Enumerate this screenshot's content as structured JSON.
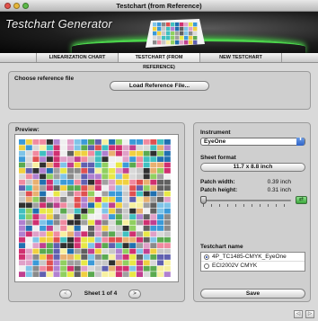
{
  "window": {
    "title": "Testchart (from Reference)"
  },
  "banner": {
    "title": "Testchart Generator"
  },
  "tabs": [
    {
      "label": "LINEARIZATION CHART",
      "active": false
    },
    {
      "label": "TESTCHART (FROM REFERENCE)",
      "active": true
    },
    {
      "label": "NEW TESTCHART",
      "active": false
    }
  ],
  "reference": {
    "label": "Choose reference file",
    "button": "Load Reference File..."
  },
  "preview": {
    "label": "Preview:",
    "page_label": "Sheet 1 of 4",
    "prev_glyph": "<",
    "next_glyph": ">"
  },
  "instrument": {
    "label": "Instrument",
    "selected": "EyeOne",
    "arrow_glyph": "⬍"
  },
  "sheet_format": {
    "label": "Sheet format",
    "value": "11.7 x 8.8 inch"
  },
  "patch": {
    "width_label": "Patch width:",
    "width_value": "0.39 inch",
    "height_label": "Patch height:",
    "height_value": "0.31 inch",
    "link_glyph": "⇄"
  },
  "testchart_name": {
    "label": "Testchart name",
    "options": [
      {
        "label": "4P_TC1485-CMYK_EyeOne",
        "selected": true
      },
      {
        "label": "ECI2002V CMYK",
        "selected": false
      }
    ]
  },
  "save": {
    "label": "Save"
  },
  "nav": {
    "left_glyph": "◁",
    "right_glyph": "▷"
  },
  "colors": {
    "accent_green": "#4cd44c",
    "select_blue": "#2f63c7"
  }
}
